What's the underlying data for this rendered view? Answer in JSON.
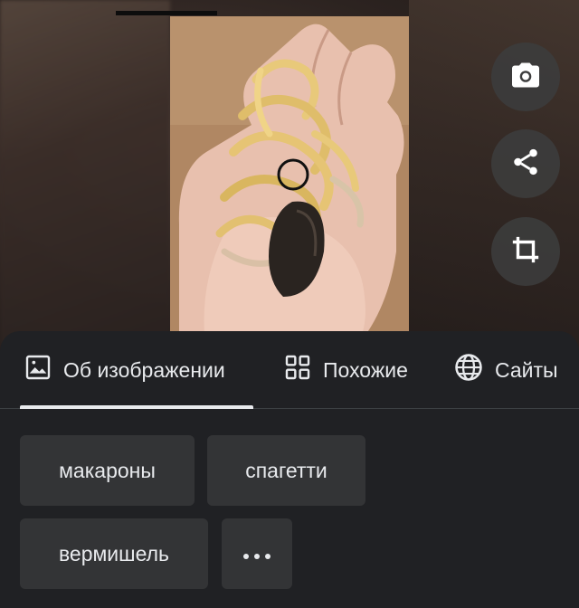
{
  "actions": {
    "camera_icon": "camera-icon",
    "share_icon": "share-icon",
    "crop_icon": "crop-icon"
  },
  "tabs": [
    {
      "label": "Об изображении",
      "icon": "image-icon",
      "selected": true
    },
    {
      "label": "Похожие",
      "icon": "grid-icon",
      "selected": false
    },
    {
      "label": "Сайты",
      "icon": "globe-icon",
      "selected": false
    }
  ],
  "chips": [
    {
      "label": "макароны"
    },
    {
      "label": "спагетти"
    },
    {
      "label": "вермишель"
    }
  ],
  "more_icon": "more-horizontal-icon",
  "colors": {
    "sheet_bg": "#202124",
    "chip_bg": "#333436",
    "text": "#e8eaed",
    "fab_bg": "#3c3c3c"
  }
}
